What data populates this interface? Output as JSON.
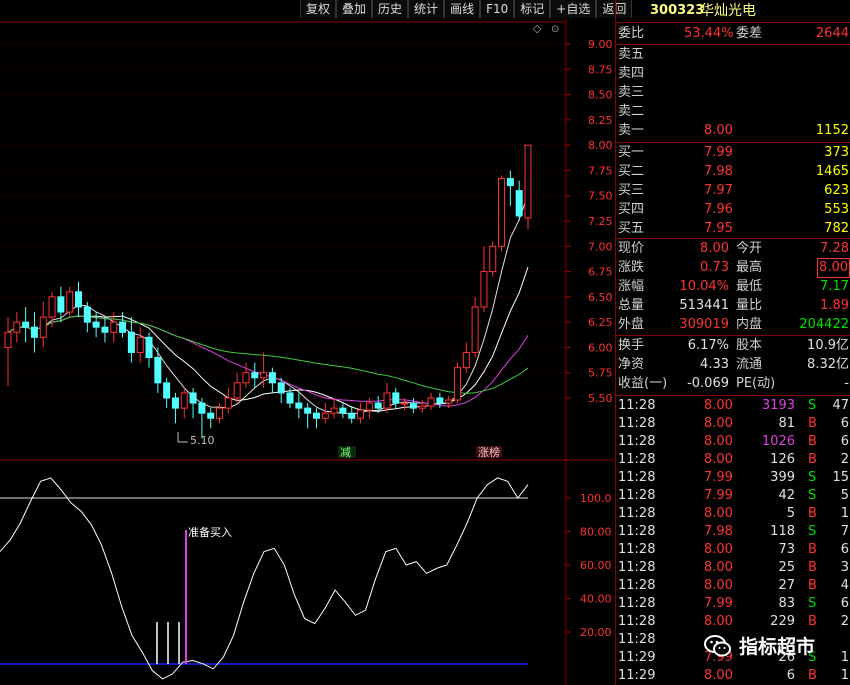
{
  "toolbar": [
    "复权",
    "叠加",
    "历史",
    "统计",
    "画线",
    "F10",
    "标记",
    "+自选",
    "返回"
  ],
  "stock": {
    "code": "300323",
    "name": "华灿光电"
  },
  "order_ratio": {
    "label": "委比",
    "value": "53.44%",
    "diff_label": "委差",
    "diff": "2644"
  },
  "asks": [
    {
      "label": "卖五",
      "price": "",
      "vol": ""
    },
    {
      "label": "卖四",
      "price": "",
      "vol": ""
    },
    {
      "label": "卖三",
      "price": "",
      "vol": ""
    },
    {
      "label": "卖二",
      "price": "",
      "vol": ""
    },
    {
      "label": "卖一",
      "price": "8.00",
      "vol": "1152"
    }
  ],
  "bids": [
    {
      "label": "买一",
      "price": "7.99",
      "vol": "373"
    },
    {
      "label": "买二",
      "price": "7.98",
      "vol": "1465"
    },
    {
      "label": "买三",
      "price": "7.97",
      "vol": "623"
    },
    {
      "label": "买四",
      "price": "7.96",
      "vol": "553"
    },
    {
      "label": "买五",
      "price": "7.95",
      "vol": "782"
    }
  ],
  "quote": [
    {
      "l1": "现价",
      "v1": "8.00",
      "c1": "red",
      "l2": "今开",
      "v2": "7.28",
      "c2": "red",
      "box2": false
    },
    {
      "l1": "涨跌",
      "v1": "0.73",
      "c1": "red",
      "l2": "最高",
      "v2": "8.00",
      "c2": "red",
      "box2": true
    },
    {
      "l1": "涨幅",
      "v1": "10.04%",
      "c1": "red",
      "l2": "最低",
      "v2": "7.17",
      "c2": "grn",
      "box2": false
    },
    {
      "l1": "总量",
      "v1": "513441",
      "c1": "wht",
      "l2": "量比",
      "v2": "1.89",
      "c2": "red",
      "box2": false
    },
    {
      "l1": "外盘",
      "v1": "309019",
      "c1": "red",
      "l2": "内盘",
      "v2": "204422",
      "c2": "grn",
      "box2": false
    }
  ],
  "fundamentals": [
    {
      "l1": "换手",
      "v1": "6.17%",
      "l2": "股本",
      "v2": "10.9亿"
    },
    {
      "l1": "净资",
      "v1": "4.33",
      "l2": "流通",
      "v2": "8.32亿"
    },
    {
      "l1": "收益(一)",
      "v1": "-0.069",
      "l2": "PE(动)",
      "v2": "-"
    }
  ],
  "ticks": [
    {
      "time": "11:28",
      "price": "8.00",
      "vol": "3193",
      "side": "S",
      "n": "47",
      "pc": "red",
      "vc": "vio"
    },
    {
      "time": "11:28",
      "price": "8.00",
      "vol": "81",
      "side": "B",
      "n": "6",
      "pc": "red",
      "vc": "wht"
    },
    {
      "time": "11:28",
      "price": "8.00",
      "vol": "1026",
      "side": "B",
      "n": "6",
      "pc": "red",
      "vc": "vio"
    },
    {
      "time": "11:28",
      "price": "8.00",
      "vol": "126",
      "side": "B",
      "n": "2",
      "pc": "red",
      "vc": "wht"
    },
    {
      "time": "11:28",
      "price": "7.99",
      "vol": "399",
      "side": "S",
      "n": "15",
      "pc": "red",
      "vc": "wht"
    },
    {
      "time": "11:28",
      "price": "7.99",
      "vol": "42",
      "side": "S",
      "n": "5",
      "pc": "red",
      "vc": "wht"
    },
    {
      "time": "11:28",
      "price": "8.00",
      "vol": "5",
      "side": "B",
      "n": "1",
      "pc": "red",
      "vc": "wht"
    },
    {
      "time": "11:28",
      "price": "7.98",
      "vol": "118",
      "side": "S",
      "n": "7",
      "pc": "red",
      "vc": "wht"
    },
    {
      "time": "11:28",
      "price": "8.00",
      "vol": "73",
      "side": "B",
      "n": "6",
      "pc": "red",
      "vc": "wht"
    },
    {
      "time": "11:28",
      "price": "8.00",
      "vol": "25",
      "side": "B",
      "n": "3",
      "pc": "red",
      "vc": "wht"
    },
    {
      "time": "11:28",
      "price": "8.00",
      "vol": "27",
      "side": "B",
      "n": "4",
      "pc": "red",
      "vc": "wht"
    },
    {
      "time": "11:28",
      "price": "7.99",
      "vol": "83",
      "side": "S",
      "n": "6",
      "pc": "red",
      "vc": "wht"
    },
    {
      "time": "11:28",
      "price": "8.00",
      "vol": "229",
      "side": "B",
      "n": "2",
      "pc": "red",
      "vc": "wht"
    },
    {
      "time": "11:28",
      "price": "",
      "vol": "",
      "side": "",
      "n": "",
      "pc": "red",
      "vc": "wht"
    },
    {
      "time": "11:29",
      "price": "7.99",
      "vol": "26",
      "side": "S",
      "n": "1",
      "pc": "red",
      "vc": "wht"
    },
    {
      "time": "11:29",
      "price": "8.00",
      "vol": "6",
      "side": "B",
      "n": "1",
      "pc": "red",
      "vc": "wht"
    }
  ],
  "watermark": "指标超市",
  "chart_data": {
    "type": "candlestick",
    "price_axis": {
      "ticks": [
        "9.00",
        "8.75",
        "8.50",
        "8.25",
        "8.00",
        "7.75",
        "7.50",
        "7.25",
        "7.00",
        "6.75",
        "6.50",
        "6.25",
        "6.00",
        "5.75",
        "5.50"
      ],
      "min": 5.5,
      "max": 9.0
    },
    "candles": [
      [
        6.0,
        6.15,
        5.62,
        6.3
      ],
      [
        6.15,
        6.25,
        6.05,
        6.35
      ],
      [
        6.25,
        6.2,
        6.05,
        6.4
      ],
      [
        6.2,
        6.1,
        5.95,
        6.35
      ],
      [
        6.1,
        6.3,
        6.0,
        6.45
      ],
      [
        6.3,
        6.5,
        6.2,
        6.55
      ],
      [
        6.5,
        6.35,
        6.25,
        6.6
      ],
      [
        6.35,
        6.55,
        6.3,
        6.6
      ],
      [
        6.55,
        6.4,
        6.3,
        6.65
      ],
      [
        6.4,
        6.25,
        6.15,
        6.45
      ],
      [
        6.25,
        6.2,
        6.1,
        6.35
      ],
      [
        6.2,
        6.15,
        6.05,
        6.3
      ],
      [
        6.15,
        6.25,
        6.05,
        6.35
      ],
      [
        6.25,
        6.15,
        6.1,
        6.35
      ],
      [
        6.15,
        5.95,
        5.85,
        6.3
      ],
      [
        5.95,
        6.1,
        5.85,
        6.2
      ],
      [
        6.1,
        5.9,
        5.8,
        6.15
      ],
      [
        5.9,
        5.65,
        5.55,
        6.0
      ],
      [
        5.65,
        5.5,
        5.4,
        5.7
      ],
      [
        5.5,
        5.4,
        5.25,
        5.55
      ],
      [
        5.4,
        5.55,
        5.3,
        5.6
      ],
      [
        5.55,
        5.45,
        5.3,
        5.6
      ],
      [
        5.45,
        5.35,
        5.1,
        5.5
      ],
      [
        5.35,
        5.3,
        5.2,
        5.4
      ],
      [
        5.3,
        5.4,
        5.25,
        5.45
      ],
      [
        5.4,
        5.5,
        5.35,
        5.6
      ],
      [
        5.5,
        5.65,
        5.45,
        5.75
      ],
      [
        5.65,
        5.75,
        5.6,
        5.85
      ],
      [
        5.75,
        5.7,
        5.6,
        5.85
      ],
      [
        5.7,
        5.75,
        5.6,
        5.95
      ],
      [
        5.75,
        5.65,
        5.55,
        5.8
      ],
      [
        5.65,
        5.55,
        5.45,
        5.7
      ],
      [
        5.55,
        5.45,
        5.4,
        5.6
      ],
      [
        5.45,
        5.4,
        5.3,
        5.55
      ],
      [
        5.4,
        5.35,
        5.2,
        5.45
      ],
      [
        5.35,
        5.3,
        5.2,
        5.4
      ],
      [
        5.3,
        5.35,
        5.25,
        5.45
      ],
      [
        5.35,
        5.4,
        5.3,
        5.5
      ],
      [
        5.4,
        5.35,
        5.3,
        5.45
      ],
      [
        5.35,
        5.3,
        5.25,
        5.42
      ],
      [
        5.3,
        5.38,
        5.25,
        5.45
      ],
      [
        5.38,
        5.45,
        5.3,
        5.5
      ],
      [
        5.45,
        5.4,
        5.35,
        5.52
      ],
      [
        5.4,
        5.55,
        5.35,
        5.65
      ],
      [
        5.55,
        5.45,
        5.4,
        5.6
      ],
      [
        5.45,
        5.45,
        5.38,
        5.5
      ],
      [
        5.45,
        5.4,
        5.35,
        5.5
      ],
      [
        5.4,
        5.42,
        5.35,
        5.48
      ],
      [
        5.42,
        5.5,
        5.38,
        5.55
      ],
      [
        5.5,
        5.45,
        5.4,
        5.55
      ],
      [
        5.45,
        5.48,
        5.4,
        5.52
      ],
      [
        5.48,
        5.8,
        5.45,
        5.85
      ],
      [
        5.8,
        5.95,
        5.75,
        6.05
      ],
      [
        5.95,
        6.4,
        5.9,
        6.5
      ],
      [
        6.4,
        6.75,
        6.35,
        7.0
      ],
      [
        6.75,
        7.0,
        6.7,
        7.05
      ],
      [
        7.0,
        7.67,
        6.95,
        7.7
      ],
      [
        7.67,
        7.6,
        7.4,
        7.75
      ],
      [
        7.55,
        7.3,
        7.25,
        7.65
      ],
      [
        7.28,
        8.0,
        7.17,
        8.0
      ]
    ],
    "annotations": {
      "low_label": "5.10",
      "tag1": "减",
      "tag2": "涨榜",
      "signal_label": "准备买入"
    },
    "osc_axis": {
      "ticks": [
        "100.0",
        "80.00",
        "60.00",
        "40.00",
        "20.00"
      ],
      "min": 0,
      "max": 100
    },
    "osc_line": [
      68,
      75,
      85,
      98,
      110,
      112,
      105,
      97,
      92,
      84,
      72,
      55,
      35,
      18,
      8,
      -3,
      -8,
      -5,
      2,
      3,
      1,
      -2,
      5,
      18,
      38,
      55,
      68,
      70,
      60,
      42,
      28,
      25,
      34,
      45,
      38,
      30,
      33,
      52,
      68,
      70,
      60,
      62,
      55,
      58,
      60,
      72,
      85,
      100,
      108,
      112,
      110,
      100,
      108
    ]
  }
}
